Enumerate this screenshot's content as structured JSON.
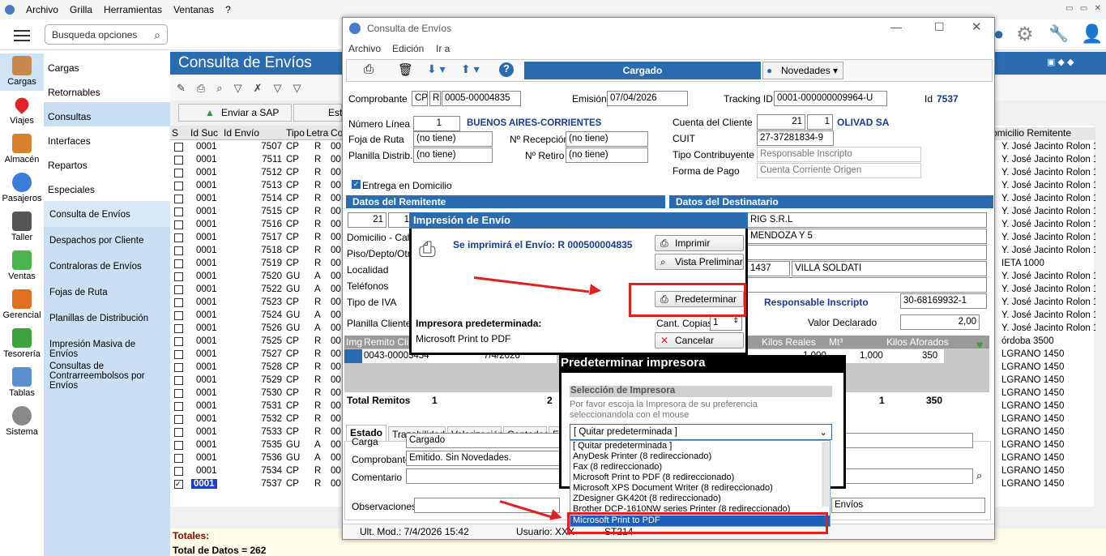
{
  "menubar": {
    "items": [
      "Archivo",
      "Grilla",
      "Herramientas",
      "Ventanas",
      "?"
    ]
  },
  "search": {
    "placeholder": "Busqueda opciones"
  },
  "rail": [
    {
      "label": "Cargas",
      "icon": "box-icon"
    },
    {
      "label": "Viajes",
      "icon": "map-pin-icon"
    },
    {
      "label": "Almacén",
      "icon": "warehouse-icon"
    },
    {
      "label": "Pasajeros",
      "icon": "person-icon"
    },
    {
      "label": "Taller",
      "icon": "tools-icon"
    },
    {
      "label": "Ventas",
      "icon": "sales-icon"
    },
    {
      "label": "Gerencial",
      "icon": "chart-icon"
    },
    {
      "label": "Tesorería",
      "icon": "money-icon"
    },
    {
      "label": "Tablas",
      "icon": "table-icon"
    },
    {
      "label": "Sistema",
      "icon": "gear-icon"
    }
  ],
  "sidebar": {
    "groups": [
      "Cargas",
      "Retornables",
      "Consultas",
      "Interfaces",
      "Repartos",
      "Especiales"
    ],
    "items": [
      "Consulta de Envíos",
      "Despachos por Cliente",
      "Contraloras de Envíos",
      "Fojas de Ruta",
      "Planillas de Distribución",
      "Impresión Masiva de Envíos",
      "Consultas de Contrarreembolsos por Envíos"
    ]
  },
  "main": {
    "title": "Consulta de Envíos",
    "sap_button": "Enviar a SAP",
    "sap_button2": "Est",
    "grid_headers": [
      "S",
      "Id Suc",
      "Id Envío",
      "Tipo",
      "Letra",
      "Co"
    ],
    "right_header": "omicilio Remitente",
    "rows": [
      {
        "suc": "0001",
        "id": "7507",
        "tipo": "CP",
        "letra": "R",
        "co": "00",
        "rem": "Y. José Jacinto Rolon 1900"
      },
      {
        "suc": "0001",
        "id": "7511",
        "tipo": "CP",
        "letra": "R",
        "co": "00",
        "rem": "Y. José Jacinto Rolon 1900"
      },
      {
        "suc": "0001",
        "id": "7512",
        "tipo": "CP",
        "letra": "R",
        "co": "00",
        "rem": "Y. José Jacinto Rolon 1900"
      },
      {
        "suc": "0001",
        "id": "7513",
        "tipo": "CP",
        "letra": "R",
        "co": "00",
        "rem": "Y. José Jacinto Rolon 1900"
      },
      {
        "suc": "0001",
        "id": "7514",
        "tipo": "CP",
        "letra": "R",
        "co": "00",
        "rem": "Y. José Jacinto Rolon 1900"
      },
      {
        "suc": "0001",
        "id": "7515",
        "tipo": "CP",
        "letra": "R",
        "co": "00",
        "rem": "Y. José Jacinto Rolon 1900"
      },
      {
        "suc": "0001",
        "id": "7516",
        "tipo": "CP",
        "letra": "R",
        "co": "00",
        "rem": "Y. José Jacinto Rolon 1900"
      },
      {
        "suc": "0001",
        "id": "7517",
        "tipo": "CP",
        "letra": "R",
        "co": "00",
        "rem": "Y. José Jacinto Rolon 1900"
      },
      {
        "suc": "0001",
        "id": "7518",
        "tipo": "CP",
        "letra": "R",
        "co": "00",
        "rem": "Y. José Jacinto Rolon 1900"
      },
      {
        "suc": "0001",
        "id": "7519",
        "tipo": "CP",
        "letra": "R",
        "co": "00",
        "rem": "IETA 1000"
      },
      {
        "suc": "0001",
        "id": "7520",
        "tipo": "GU",
        "letra": "A",
        "co": "00",
        "rem": "Y. José Jacinto Rolon 1900"
      },
      {
        "suc": "0001",
        "id": "7522",
        "tipo": "GU",
        "letra": "A",
        "co": "00",
        "rem": "Y. José Jacinto Rolon 1900"
      },
      {
        "suc": "0001",
        "id": "7523",
        "tipo": "CP",
        "letra": "R",
        "co": "00",
        "rem": "Y. José Jacinto Rolon 1900"
      },
      {
        "suc": "0001",
        "id": "7524",
        "tipo": "GU",
        "letra": "A",
        "co": "00",
        "rem": "Y. José Jacinto Rolon 1900"
      },
      {
        "suc": "0001",
        "id": "7526",
        "tipo": "GU",
        "letra": "A",
        "co": "00",
        "rem": "Y. José Jacinto Rolon 1900"
      },
      {
        "suc": "0001",
        "id": "7525",
        "tipo": "CP",
        "letra": "R",
        "co": "00",
        "rem": "órdoba 3500"
      },
      {
        "suc": "0001",
        "id": "7527",
        "tipo": "CP",
        "letra": "R",
        "co": "00",
        "rem": "LGRANO 1450"
      },
      {
        "suc": "0001",
        "id": "7528",
        "tipo": "CP",
        "letra": "R",
        "co": "00",
        "rem": "LGRANO 1450"
      },
      {
        "suc": "0001",
        "id": "7529",
        "tipo": "CP",
        "letra": "R",
        "co": "00",
        "rem": "LGRANO 1450"
      },
      {
        "suc": "0001",
        "id": "7530",
        "tipo": "CP",
        "letra": "R",
        "co": "00",
        "rem": "LGRANO 1450"
      },
      {
        "suc": "0001",
        "id": "7531",
        "tipo": "CP",
        "letra": "R",
        "co": "00",
        "rem": "LGRANO 1450"
      },
      {
        "suc": "0001",
        "id": "7532",
        "tipo": "CP",
        "letra": "R",
        "co": "00",
        "rem": "LGRANO 1450"
      },
      {
        "suc": "0001",
        "id": "7533",
        "tipo": "CP",
        "letra": "R",
        "co": "00",
        "rem": "LGRANO 1450"
      },
      {
        "suc": "0001",
        "id": "7535",
        "tipo": "GU",
        "letra": "A",
        "co": "00",
        "rem": "LGRANO 1450"
      },
      {
        "suc": "0001",
        "id": "7536",
        "tipo": "GU",
        "letra": "A",
        "co": "00",
        "rem": "LGRANO 1450"
      },
      {
        "suc": "0001",
        "id": "7534",
        "tipo": "CP",
        "letra": "R",
        "co": "00",
        "rem": "LGRANO 1450"
      },
      {
        "suc": "0001",
        "id": "7537",
        "tipo": "CP",
        "letra": "R",
        "co": "00",
        "rem": "LGRANO 1450"
      }
    ],
    "totals_label": "Totales:",
    "total_datos": "Total de Datos = 262"
  },
  "dialog": {
    "title": "Consulta de Envíos",
    "menu": [
      "Archivo",
      "Edición",
      "Ir a"
    ],
    "status": "Cargado",
    "novedades": "Novedades",
    "comprobante_label": "Comprobante",
    "comp_tipo": "CP",
    "comp_letra": "R",
    "comp_num": "0005-00004835",
    "emision_label": "Emisión",
    "emision": "07/04/2026",
    "tracking_label": "Tracking ID",
    "tracking": "0001-000000009964-U",
    "id_label": "Id",
    "id": "7537",
    "numero_linea_label": "Número Línea",
    "numero_linea": "1",
    "linea_nombre": "BUENOS AIRES-CORRIENTES",
    "foja_label": "Foja de Ruta",
    "foja": "(no tiene)",
    "planilla_label": "Planilla Distrib.",
    "planilla": "(no tiene)",
    "recepcion_label": "Nº Recepción",
    "recepcion": "(no tiene)",
    "retiro_label": "Nº Retiro",
    "retiro": "(no tiene)",
    "cuenta_label": "Cuenta del Cliente",
    "cuenta1": "21",
    "cuenta2": "1",
    "cliente": "OLIVAD SA",
    "cuit_label": "CUIT",
    "cuit": "27-37281834-9",
    "tipo_contrib_label": "Tipo Contribuyente",
    "tipo_contrib": "Responsable Inscripto",
    "forma_pago_label": "Forma de Pago",
    "forma_pago": "Cuenta Corriente Origen",
    "entrega_dom": "Entrega en Domicilio",
    "remitente_hdr": "Datos del Remitente",
    "destinatario_hdr": "Datos del Destinatario",
    "rem_cod": "21",
    "rem_cod2": "1",
    "domicilio_label": "Domicilio - Calle/",
    "piso_label": "Piso/Depto/Otro",
    "localidad_label": "Localidad",
    "telefonos_label": "Teléfonos",
    "tipo_iva_label": "Tipo de IVA",
    "dest_nombre": "RIG S.R.L",
    "dest_calle": "MENDOZA Y 5",
    "dest_cp": "1437",
    "dest_loc": "VILLA SOLDATI",
    "dest_iva": "Responsable Inscripto",
    "dest_cuit": "30-68169932-1",
    "planilla_cliente_label": "Planilla Cliente",
    "valor_declarado_label": "Valor Declarado",
    "valor_declarado": "2,00",
    "rem_headers": [
      "Img",
      "Remito Clie"
    ],
    "rem_row": "0043-00003454",
    "rem_date": "7/4/2026",
    "kilos_hdr": [
      "Kilos Reales",
      "Mt³",
      "Kilos Aforados"
    ],
    "kilos_row": [
      "1,000",
      "1,000",
      "350"
    ],
    "total_remitos_label": "Total Remitos",
    "total_remitos": [
      "1",
      "2",
      "1",
      "350"
    ],
    "tabs": [
      "Estado",
      "Trazabilidad",
      "Valorización",
      "Contados",
      "Fa"
    ],
    "carga_label": "Carga",
    "carga": "Cargado",
    "comprobante2_label": "Comprobante",
    "comprobante2": "Emitido. Sin Novedades.",
    "comentario_label": "Comentario",
    "observaciones_label": "Observaciones",
    "obs_right": "Envíos",
    "footer_mod": "Ult. Mod.: 7/4/2026 15:42",
    "footer_user": "Usuario: XXX",
    "footer_st": "ST214"
  },
  "print_dialog": {
    "title": "Impresión de Envío",
    "msg": "Se imprimirá el Envío: R 000500004835",
    "btn_print": "Imprimir",
    "btn_preview": "Vista Preliminar",
    "btn_default": "Predeterminar",
    "btn_cancel": "Cancelar",
    "printer_label": "Impresora predeterminada:",
    "printer": "Microsoft Print to PDF",
    "copies_label": "Cant. Copias",
    "copies": "1"
  },
  "printer_dialog": {
    "title": "Predeterminar impresora",
    "section": "Selección de Impresora",
    "hint": "Por favor escoja la Impresora de su preferencia seleccionandola con el mouse",
    "selected": "[ Quitar predeterminada ]",
    "options": [
      "[ Quitar predeterminada ]",
      "AnyDesk Printer (8 redireccionado)",
      "Fax (8 redireccionado)",
      "Microsoft Print to PDF (8 redireccionado)",
      "Microsoft XPS Document Writer (8 redireccionado)",
      "ZDesigner GK420t (8 redireccionado)",
      "Brother DCP-1610NW series Printer (8 redireccionado)",
      "Microsoft Print to PDF"
    ]
  },
  "colors": {
    "accent": "#2b6cb0",
    "highlight": "#c8dff4",
    "annotation": "#e02020"
  }
}
